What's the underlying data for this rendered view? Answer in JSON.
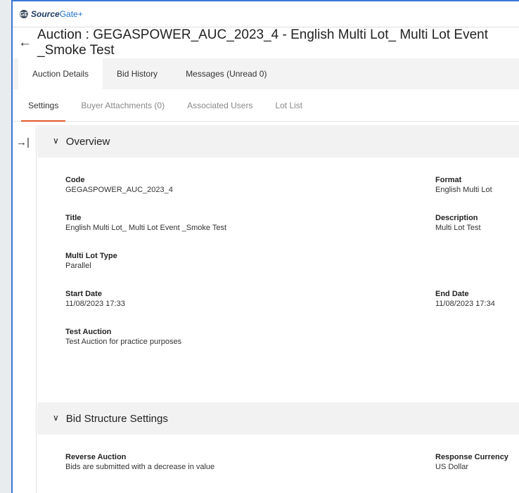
{
  "brand": {
    "logo": "GE",
    "name_part1": "Source",
    "name_part2": "Gate+"
  },
  "header": {
    "title": "Auction : GEGASPOWER_AUC_2023_4 - English Multi Lot_ Multi Lot Event _Smoke Test"
  },
  "primary_tabs": [
    {
      "label": "Auction Details",
      "active": true
    },
    {
      "label": "Bid History",
      "active": false
    },
    {
      "label": "Messages (Unread 0)",
      "active": false
    }
  ],
  "secondary_tabs": [
    {
      "label": "Settings",
      "active": true
    },
    {
      "label": "Buyer Attachments (0)",
      "active": false
    },
    {
      "label": "Associated Users",
      "active": false
    },
    {
      "label": "Lot List",
      "active": false
    }
  ],
  "overview": {
    "heading": "Overview",
    "code_label": "Code",
    "code_value": "GEGASPOWER_AUC_2023_4",
    "format_label": "Format",
    "format_value": "English Multi Lot",
    "title_label": "Title",
    "title_value": "English Multi Lot_ Multi Lot Event _Smoke Test",
    "description_label": "Description",
    "description_value": "Multi Lot Test",
    "multilot_label": "Multi Lot Type",
    "multilot_value": "Parallel",
    "start_label": "Start Date",
    "start_value": "11/08/2023 17:33",
    "end_label": "End Date",
    "end_value": "11/08/2023 17:34",
    "test_label": "Test Auction",
    "test_value": "Test Auction for practice purposes"
  },
  "bid_structure": {
    "heading": "Bid Structure Settings",
    "reverse_label": "Reverse Auction",
    "reverse_value": "Bids are submitted with a decrease in value",
    "currency_label": "Response Currency",
    "currency_value": "US Dollar"
  },
  "icons": {
    "back": "back-arrow-icon",
    "chevron": "chevron-down-icon",
    "sidebar_toggle": "expand-sidebar-icon"
  },
  "colors": {
    "active_tab_underline": "#e15a2b",
    "section_bg": "#f2f2f2",
    "frame_border": "#3a78d4"
  }
}
